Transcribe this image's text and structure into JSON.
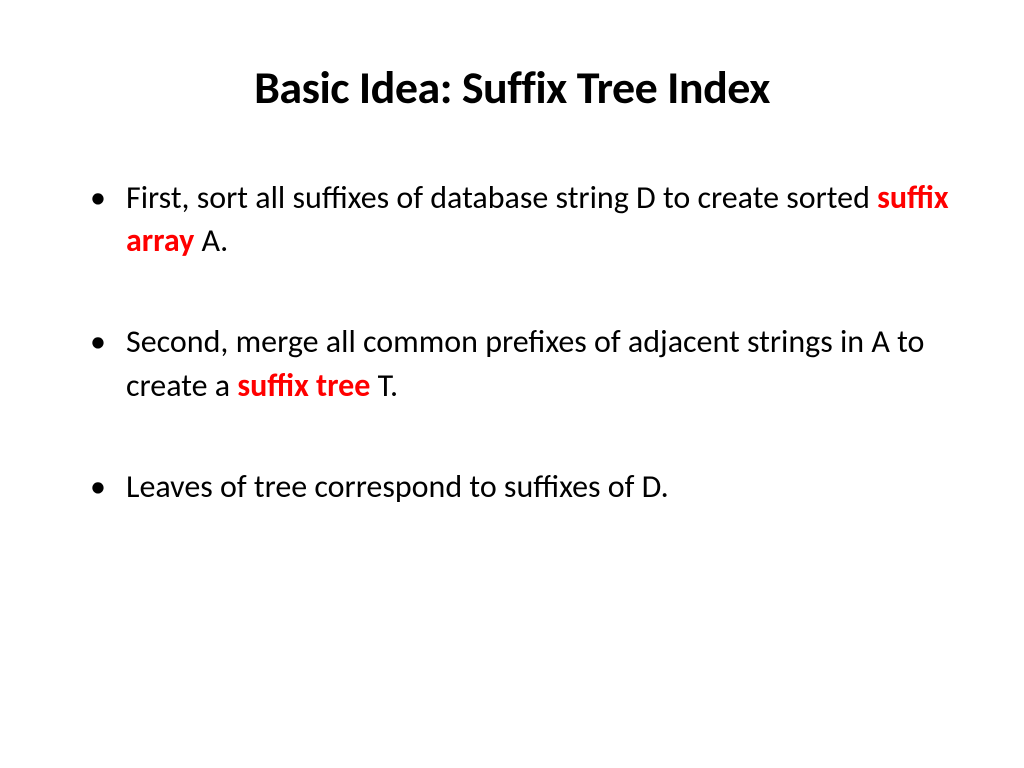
{
  "title": "Basic Idea: Suffix Tree Index",
  "bullets": [
    {
      "pre": "First, sort all suffixes of database string D to create sorted ",
      "highlight": "suffix array",
      "post": " A."
    },
    {
      "pre": "Second, merge all common prefixes of adjacent strings in A to create a ",
      "highlight": "suffix tree",
      "post": " T."
    },
    {
      "pre": "Leaves of tree correspond to suffixes of D.",
      "highlight": "",
      "post": ""
    }
  ]
}
